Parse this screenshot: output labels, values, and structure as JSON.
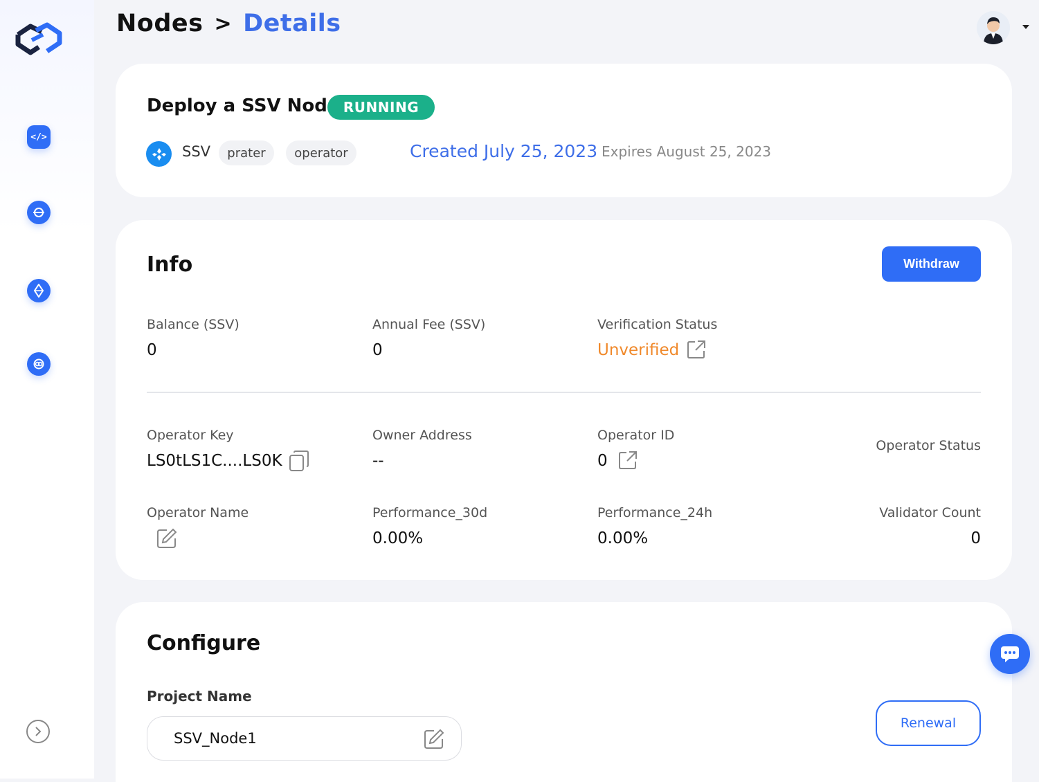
{
  "header": {
    "breadcrumb_root": "Nodes",
    "breadcrumb_sep": ">",
    "breadcrumb_current": "Details"
  },
  "sidebar": {
    "items": [
      {
        "icon": "code-icon"
      },
      {
        "icon": "network-icon"
      },
      {
        "icon": "ethereum-icon"
      },
      {
        "icon": "link-icon"
      }
    ],
    "collapse_icon": "chevron-right-icon"
  },
  "deploy": {
    "title": "Deploy a SSV Node",
    "status": "RUNNING",
    "status_color": "#1bb08a",
    "network": "SSV",
    "tags": [
      "prater",
      "operator"
    ],
    "created": "Created July 25, 2023",
    "expires": "Expires August 25, 2023"
  },
  "info": {
    "title": "Info",
    "withdraw_label": "Withdraw",
    "balance_label": "Balance (SSV)",
    "balance_value": "0",
    "annual_fee_label": "Annual Fee (SSV)",
    "annual_fee_value": "0",
    "verification_label": "Verification Status",
    "verification_value": "Unverified",
    "operator_key_label": "Operator Key",
    "operator_key_value": "LS0tLS1C....LS0K",
    "owner_address_label": "Owner Address",
    "owner_address_value": "--",
    "operator_id_label": "Operator ID",
    "operator_id_value": "0",
    "operator_status_label": "Operator Status",
    "operator_name_label": "Operator Name",
    "perf30_label": "Performance_30d",
    "perf30_value": "0.00%",
    "perf24_label": "Performance_24h",
    "perf24_value": "0.00%",
    "validator_count_label": "Validator Count",
    "validator_count_value": "0"
  },
  "configure": {
    "title": "Configure",
    "project_name_label": "Project Name",
    "project_name_value": "SSV_Node1",
    "renewal_label": "Renewal"
  },
  "colors": {
    "accent": "#2f6df6",
    "link": "#3e6ee8",
    "warning": "#f0892b",
    "background": "#f3f4f8"
  }
}
